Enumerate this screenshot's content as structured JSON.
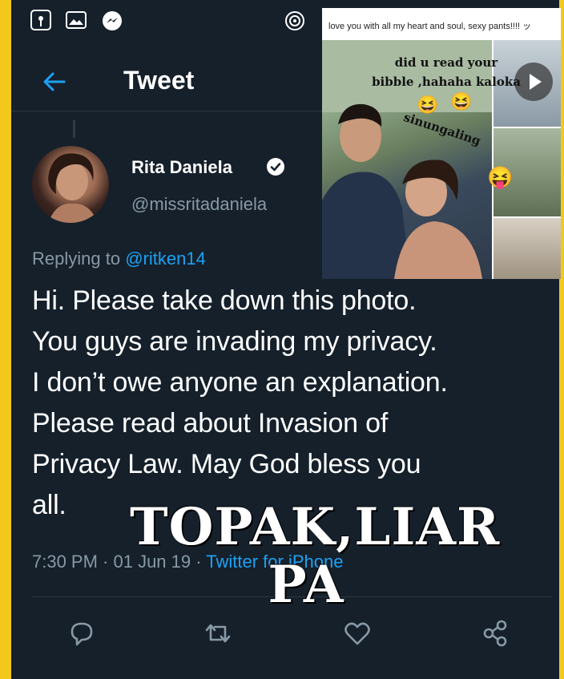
{
  "header": {
    "title": "Tweet"
  },
  "tweet": {
    "display_name": "Rita Daniela",
    "handle": "@missritadaniela",
    "replying_prefix": "Replying to",
    "replying_to": "@ritken14",
    "text_lines": [
      "Hi. Please take down this photo.",
      "You guys are invading my privacy.",
      "I don’t owe anyone an explanation.",
      "Please read about Invasion of",
      "Privacy Law. May God bless you",
      "all."
    ],
    "timestamp": "7:30 PM · 01 Jun 19 · ",
    "source": "Twitter for iPhone"
  },
  "overlay": {
    "caption_line1": "TOPAK,LIAR",
    "caption_line2": "PA"
  },
  "inset": {
    "top_text": "love you with all my heart and soul, sexy pants!!!! ッ",
    "caption_line1": "did u read your",
    "caption_line2": "bibble ,hahaha kaloka",
    "label": "sinungaling",
    "emoji_1": "😆",
    "emoji_2": "😆",
    "emoji_3": "😝"
  },
  "colors": {
    "background": "#f2c81c",
    "app_bg": "#15202b",
    "accent": "#1da1f2",
    "secondary_text": "#8899a6"
  }
}
